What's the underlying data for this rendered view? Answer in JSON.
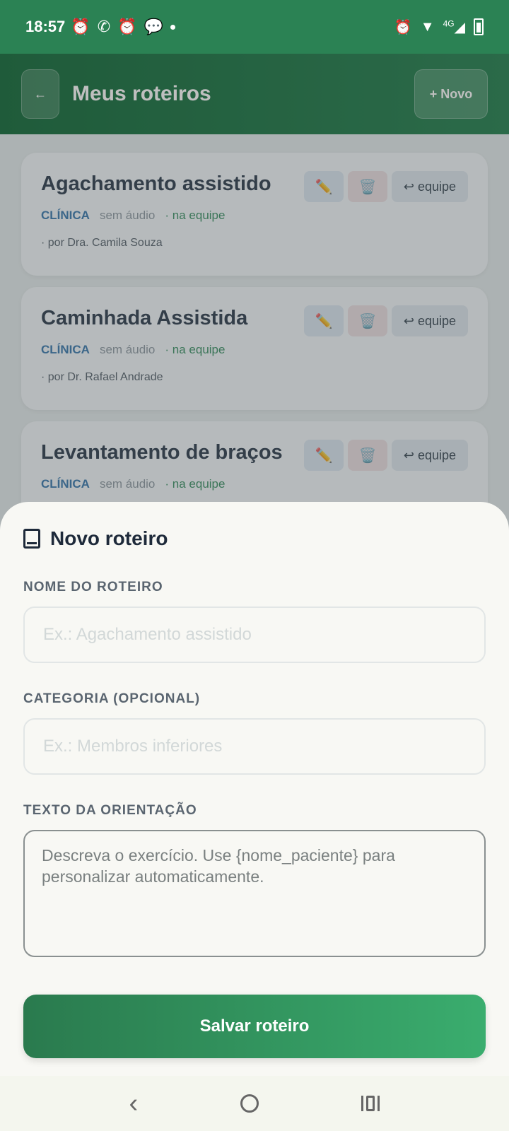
{
  "status_bar": {
    "time": "18:57",
    "network": "4G",
    "left_icons": [
      "alarm-icon",
      "whatsapp-icon",
      "alarm-icon",
      "chat-icon",
      "dot"
    ],
    "right_icons": [
      "alarm-icon",
      "wifi-icon",
      "signal-icon",
      "battery-icon"
    ]
  },
  "header": {
    "back_label": "←",
    "title": "Meus roteiros",
    "new_label": "+ Novo"
  },
  "cards": [
    {
      "title": "Agachamento assistido",
      "category": "CLÍNICA",
      "audio": "sem áudio",
      "team": "· na equipe",
      "author": "· por Dra. Camila Souza"
    },
    {
      "title": "Caminhada Assistida",
      "category": "CLÍNICA",
      "audio": "sem áudio",
      "team": "· na equipe",
      "author": "· por Dr. Rafael Andrade"
    },
    {
      "title": "Levantamento de braços",
      "category": "CLÍNICA",
      "audio": "sem áudio",
      "team": "· na equipe",
      "author": ""
    }
  ],
  "card_actions": {
    "edit_icon": "✏️",
    "delete_icon": "🗑️",
    "team_label": "↩ equipe"
  },
  "sheet": {
    "title": "Novo roteiro",
    "name_label": "NOME DO ROTEIRO",
    "name_placeholder": "Ex.: Agachamento assistido",
    "category_label": "CATEGORIA (OPCIONAL)",
    "category_placeholder": "Ex.: Membros inferiores",
    "text_label": "TEXTO DA ORIENTAÇÃO",
    "text_placeholder": "Descreva o exercício. Use {nome_paciente} para personalizar automaticamente.",
    "save_label": "Salvar roteiro"
  },
  "colors": {
    "brand_green": "#2b8254",
    "category_blue": "#2b6fa8",
    "team_green": "#2d8a55"
  }
}
